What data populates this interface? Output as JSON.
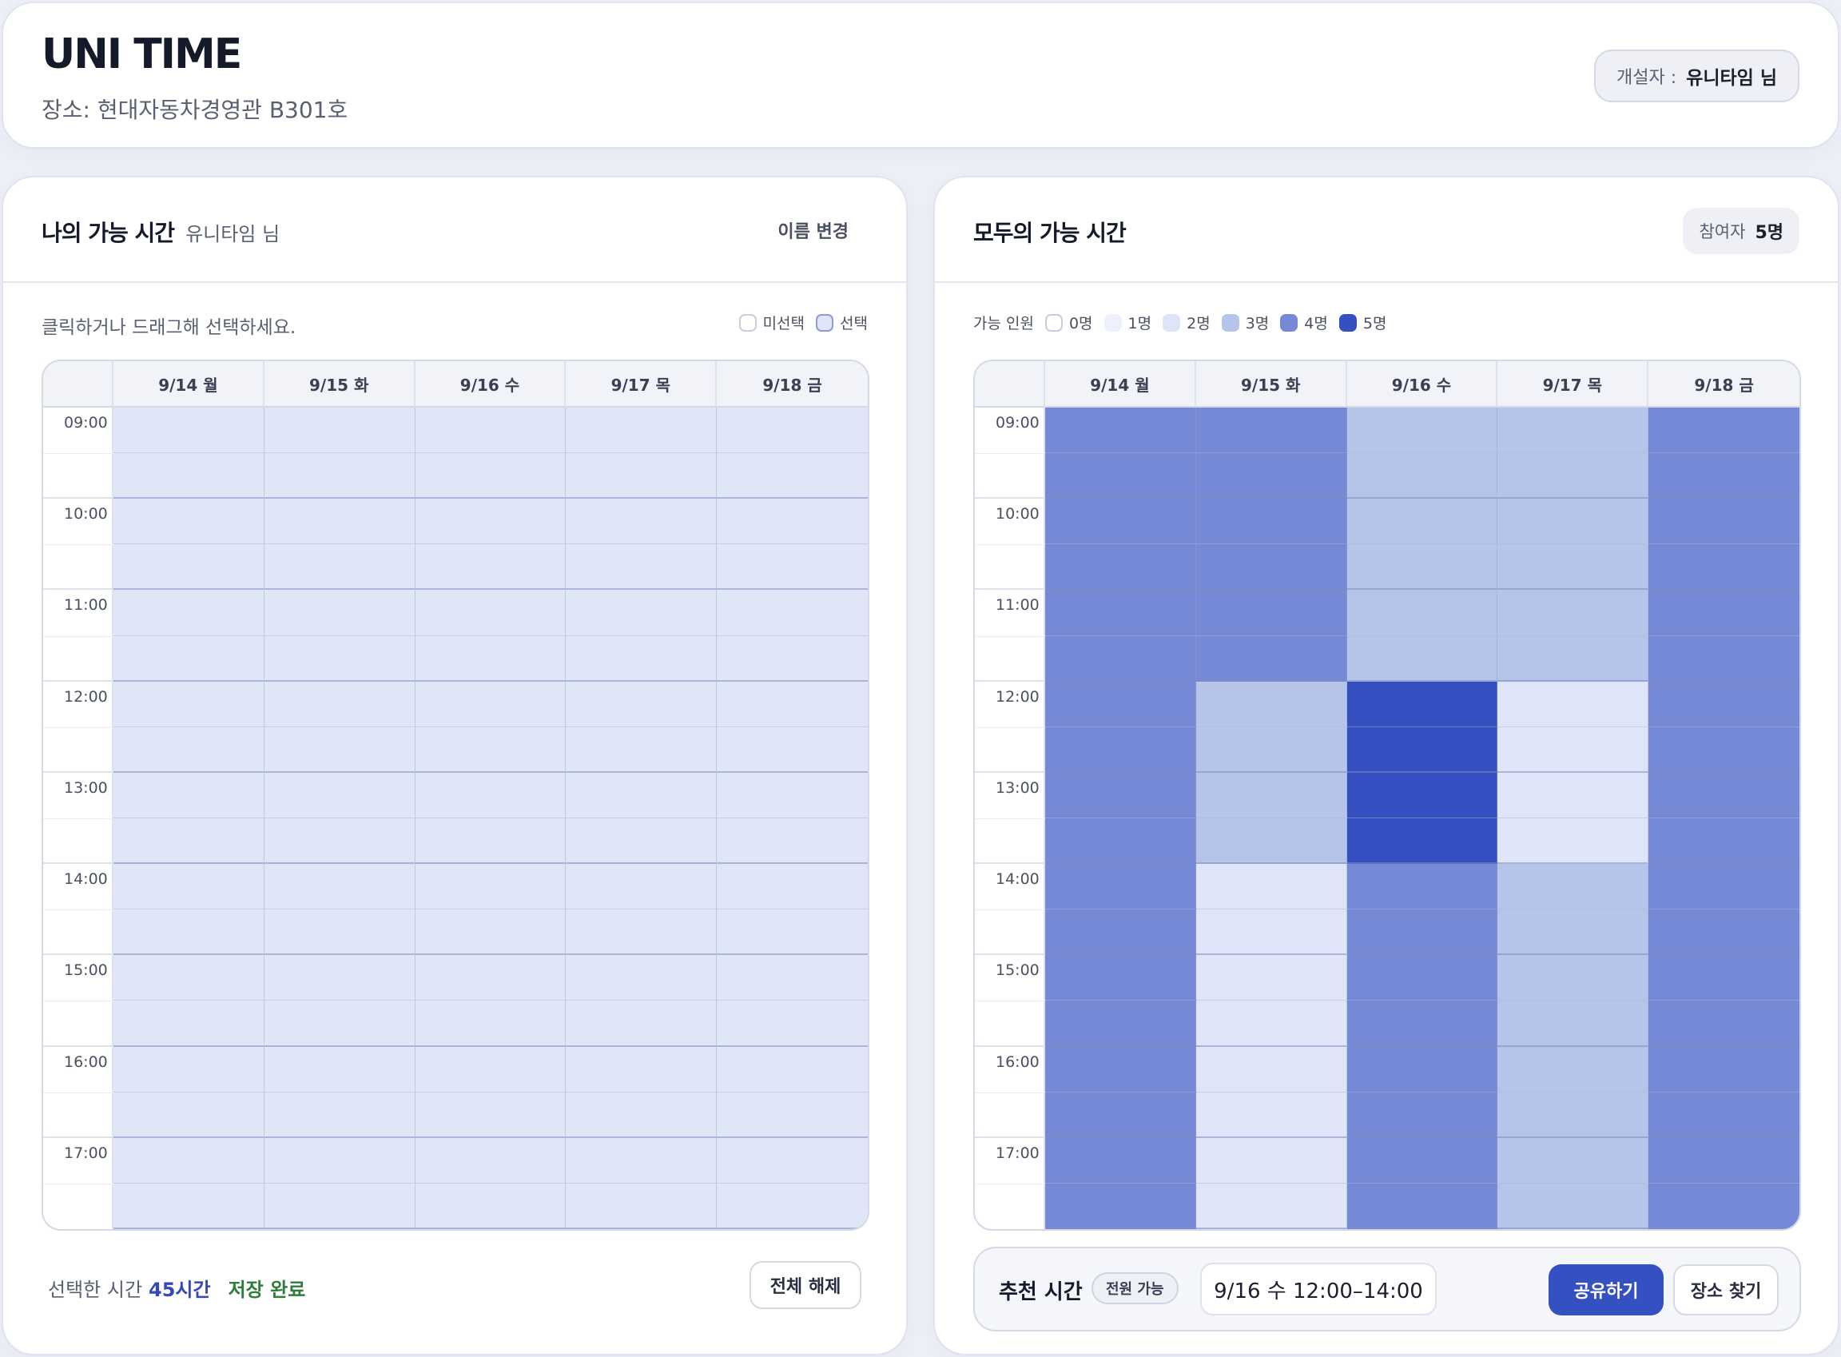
{
  "header": {
    "brand": "UNI TIME",
    "place": "장소: 현대자동차경영관 B301호",
    "host_label": "개설자 :",
    "host_name": "유니타임 님"
  },
  "my_panel": {
    "title": "나의 가능 시간",
    "user": "유니타임 님",
    "rename_label": "이름 변경",
    "hint": "클릭하거나 드래그해 선택하세요.",
    "legend": [
      {
        "label": "미선택",
        "color": "#ffffff",
        "border": "#c9cedc"
      },
      {
        "label": "선택",
        "color": "#dfe6f8",
        "border": "#8f9ad0"
      }
    ],
    "selected_label": "선택한 시간",
    "selected_hours": "45시간",
    "save_status": "저장 완료",
    "clear_label": "전체 해제"
  },
  "all_panel": {
    "title": "모두의 가능 시간",
    "participants_label": "참여자",
    "participants_count": "5명",
    "legend_title": "가능 인원",
    "legend": [
      {
        "label": "0명",
        "color": "#ffffff",
        "border": "#c9cedc"
      },
      {
        "label": "1명",
        "color": "#eef1fb",
        "border": "#eef1fb"
      },
      {
        "label": "2명",
        "color": "#dfe5f8",
        "border": "#dfe5f8"
      },
      {
        "label": "3명",
        "color": "#b7c4ea",
        "border": "#b7c4ea"
      },
      {
        "label": "4명",
        "color": "#7689d6",
        "border": "#7689d6"
      },
      {
        "label": "5명",
        "color": "#3550c0",
        "border": "#3550c0"
      }
    ],
    "recommend_title": "추천 시간",
    "recommend_badge": "전원 가능",
    "recommend_time": "9/16 수 12:00–14:00",
    "share_label": "공유하기",
    "find_place_label": "장소 찾기"
  },
  "schedule": {
    "days": [
      "9/14 월",
      "9/15 화",
      "9/16 수",
      "9/17 목",
      "9/18 금"
    ],
    "times": [
      "09:00",
      "10:00",
      "11:00",
      "12:00",
      "13:00",
      "14:00",
      "15:00",
      "16:00",
      "17:00"
    ],
    "my_selected": [
      [
        1,
        1,
        1,
        1,
        1,
        1,
        1,
        1,
        1,
        1,
        1,
        1,
        1,
        1,
        1,
        1,
        1,
        1
      ],
      [
        1,
        1,
        1,
        1,
        1,
        1,
        1,
        1,
        1,
        1,
        1,
        1,
        1,
        1,
        1,
        1,
        1,
        1
      ],
      [
        1,
        1,
        1,
        1,
        1,
        1,
        1,
        1,
        1,
        1,
        1,
        1,
        1,
        1,
        1,
        1,
        1,
        1
      ],
      [
        1,
        1,
        1,
        1,
        1,
        1,
        1,
        1,
        1,
        1,
        1,
        1,
        1,
        1,
        1,
        1,
        1,
        1
      ],
      [
        1,
        1,
        1,
        1,
        1,
        1,
        1,
        1,
        1,
        1,
        1,
        1,
        1,
        1,
        1,
        1,
        1,
        1
      ]
    ],
    "availability": [
      [
        4,
        4,
        4,
        4,
        4,
        4,
        4,
        4,
        4,
        4,
        4,
        4,
        4,
        4,
        4,
        4,
        4,
        4
      ],
      [
        4,
        4,
        4,
        4,
        4,
        4,
        3,
        3,
        3,
        3,
        2,
        2,
        2,
        2,
        2,
        2,
        2,
        2
      ],
      [
        3,
        3,
        3,
        3,
        3,
        3,
        5,
        5,
        5,
        5,
        4,
        4,
        4,
        4,
        4,
        4,
        4,
        4
      ],
      [
        3,
        3,
        3,
        3,
        3,
        3,
        2,
        2,
        2,
        2,
        3,
        3,
        3,
        3,
        3,
        3,
        3,
        3
      ],
      [
        4,
        4,
        4,
        4,
        4,
        4,
        4,
        4,
        4,
        4,
        4,
        4,
        4,
        4,
        4,
        4,
        4,
        4
      ]
    ]
  }
}
